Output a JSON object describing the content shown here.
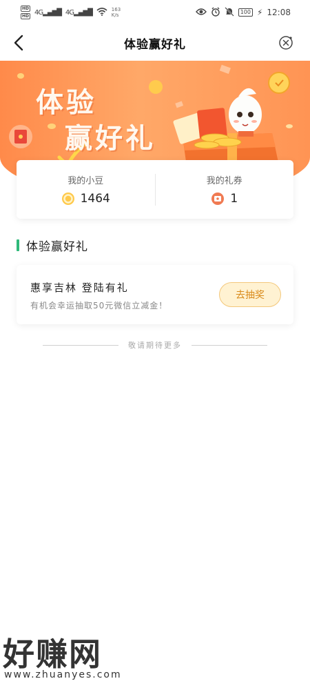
{
  "status_bar": {
    "hd1": "HD",
    "hd2": "HD",
    "network1": "4G",
    "network2": "4G",
    "speed_value": "163",
    "speed_unit": "K/s",
    "battery": "100",
    "time": "12:08"
  },
  "nav": {
    "title": "体验赢好礼"
  },
  "banner": {
    "line1": "体验",
    "line2": "赢好礼"
  },
  "summary": {
    "beans_label": "我的小豆",
    "beans_value": "1464",
    "coupons_label": "我的礼券",
    "coupons_value": "1"
  },
  "section": {
    "title": "体验赢好礼"
  },
  "activity": {
    "title": "惠享吉林 登陆有礼",
    "description": "有机会幸运抽取50元微信立减金！",
    "button_label": "去抽奖"
  },
  "footer": {
    "end_text": "敬请期待更多"
  },
  "watermark": {
    "big_text": "好赚网",
    "url": "www.zhuanyes.com"
  },
  "colors": {
    "banner": "#ff9a5a",
    "accent_green": "#2fb97a",
    "button_bg": "#fff2d2",
    "button_text": "#d98a1a"
  }
}
